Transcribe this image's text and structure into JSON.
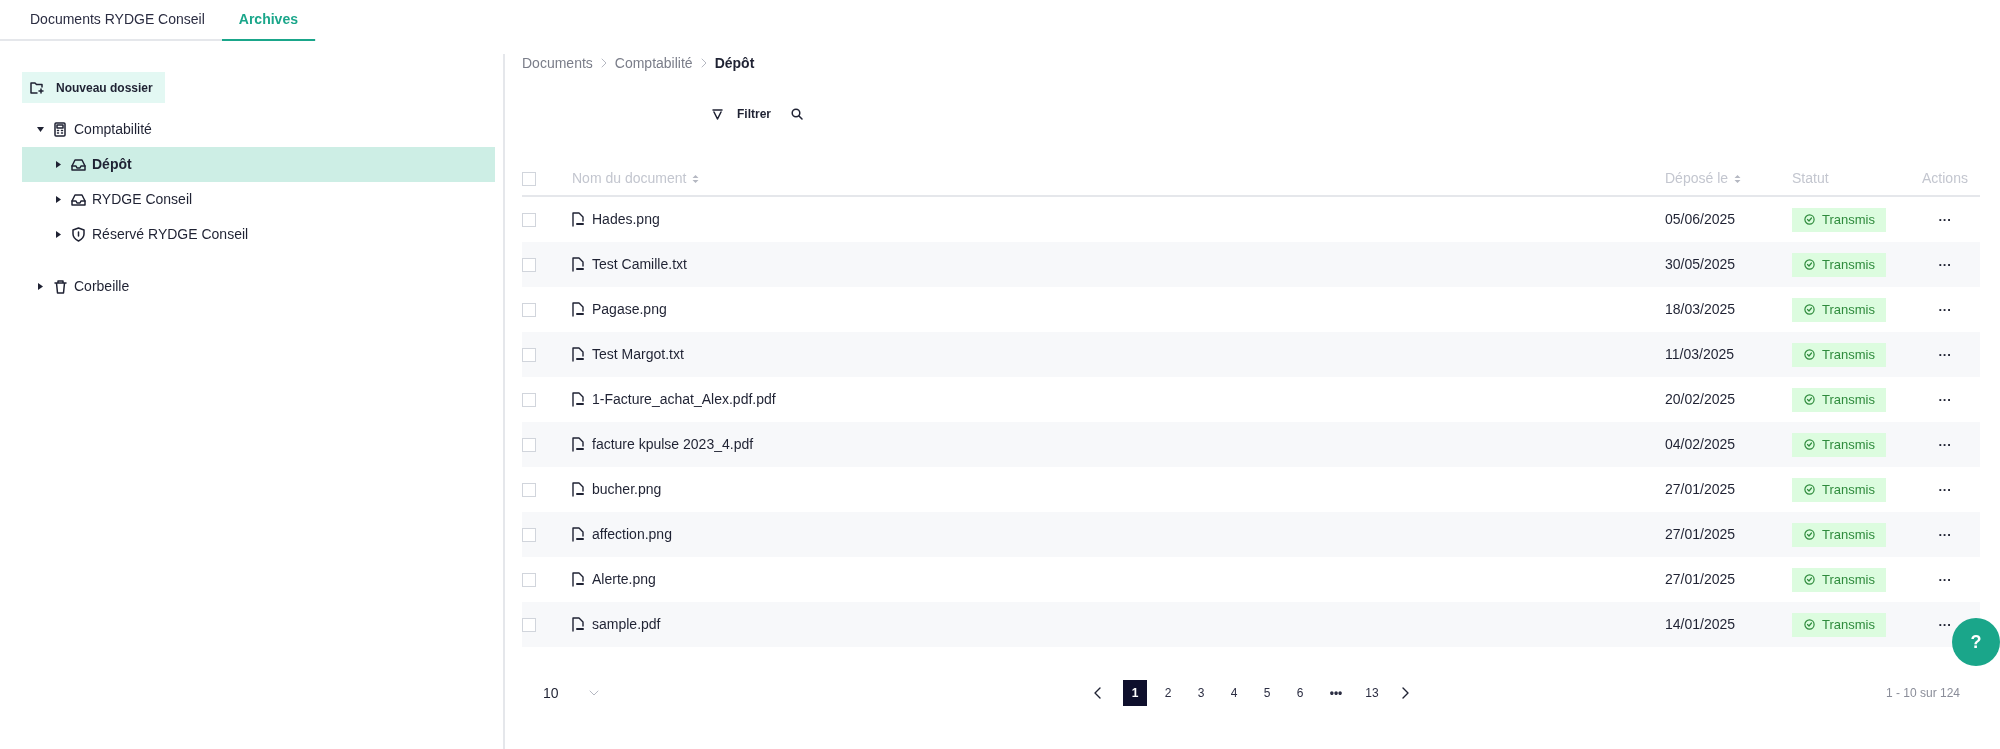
{
  "tabs": [
    {
      "label": "Documents RYDGE Conseil",
      "selected": false
    },
    {
      "label": "Archives",
      "selected": true
    }
  ],
  "new_folder_button": "Nouveau dossier",
  "tree": [
    {
      "label": "Comptabilité",
      "kind": "calculator",
      "expanded": true,
      "selected": false,
      "children": [
        {
          "label": "Dépôt",
          "kind": "inbox",
          "expanded": false,
          "selected": true
        },
        {
          "label": "RYDGE Conseil",
          "kind": "inbox",
          "expanded": false,
          "selected": false
        },
        {
          "label": "Réservé RYDGE Conseil",
          "kind": "shield",
          "expanded": false,
          "selected": false
        }
      ]
    },
    {
      "label": "Corbeille",
      "kind": "trash",
      "expanded": false,
      "selected": false
    }
  ],
  "breadcrumb": [
    {
      "label": "Documents",
      "current": false
    },
    {
      "label": "Comptabilité",
      "current": false
    },
    {
      "label": "Dépôt",
      "current": true
    }
  ],
  "toolbar": {
    "filter_label": "Filtrer"
  },
  "table": {
    "header_checked": false,
    "columns": [
      {
        "label": "Nom du document",
        "sortable": true
      },
      {
        "label": "Déposé le",
        "sortable": true
      },
      {
        "label": "Statut",
        "sortable": false
      },
      {
        "label": "Actions",
        "sortable": false
      }
    ],
    "rows": [
      {
        "checked": false,
        "name": "Hades.png",
        "date": "05/06/2025",
        "status": "Transmis",
        "actions": "···"
      },
      {
        "checked": false,
        "name": "Test Camille.txt",
        "date": "30/05/2025",
        "status": "Transmis",
        "actions": "···"
      },
      {
        "checked": false,
        "name": "Pagase.png",
        "date": "18/03/2025",
        "status": "Transmis",
        "actions": "···"
      },
      {
        "checked": false,
        "name": "Test Margot.txt",
        "date": "11/03/2025",
        "status": "Transmis",
        "actions": "···"
      },
      {
        "checked": false,
        "name": "1-Facture_achat_Alex.pdf.pdf",
        "date": "20/02/2025",
        "status": "Transmis",
        "actions": "···"
      },
      {
        "checked": false,
        "name": "facture kpulse 2023_4.pdf",
        "date": "04/02/2025",
        "status": "Transmis",
        "actions": "···"
      },
      {
        "checked": false,
        "name": "bucher.png",
        "date": "27/01/2025",
        "status": "Transmis",
        "actions": "···"
      },
      {
        "checked": false,
        "name": "affection.png",
        "date": "27/01/2025",
        "status": "Transmis",
        "actions": "···"
      },
      {
        "checked": false,
        "name": "Alerte.png",
        "date": "27/01/2025",
        "status": "Transmis",
        "actions": "···"
      },
      {
        "checked": false,
        "name": "sample.pdf",
        "date": "14/01/2025",
        "status": "Transmis",
        "actions": "···"
      }
    ]
  },
  "pagination": {
    "page_size": "10",
    "pages": [
      {
        "label": "1",
        "selected": true,
        "kind": "page"
      },
      {
        "label": "2",
        "selected": false,
        "kind": "page"
      },
      {
        "label": "3",
        "selected": false,
        "kind": "page"
      },
      {
        "label": "4",
        "selected": false,
        "kind": "page"
      },
      {
        "label": "5",
        "selected": false,
        "kind": "page"
      },
      {
        "label": "6",
        "selected": false,
        "kind": "page"
      },
      {
        "label": "•••",
        "selected": false,
        "kind": "ellipsis"
      },
      {
        "label": "13",
        "selected": false,
        "kind": "page"
      }
    ],
    "summary": "1 - 10 sur 124"
  },
  "help_button": "?"
}
